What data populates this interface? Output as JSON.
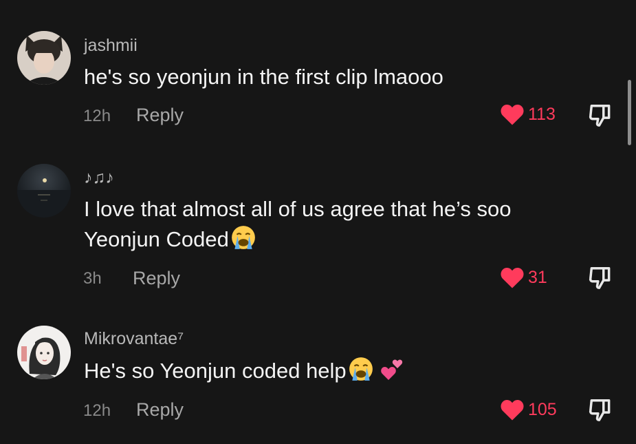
{
  "comments": [
    {
      "username": "jashmii",
      "text": "he's so yeonjun in the first clip lmaooo",
      "time": "12h",
      "reply_label": "Reply",
      "likes": "113",
      "avatar_icon": "user-avatar-cat-ears"
    },
    {
      "username": "♪♫♪",
      "text": "I love that almost all of us agree that he’s soo Yeonjun Coded",
      "emojis": [
        "loudly-crying-face"
      ],
      "time": "3h",
      "reply_label": "Reply",
      "likes": "31",
      "avatar_icon": "user-avatar-night-moon"
    },
    {
      "username": "Mikrovantae⁷",
      "text": "He's so Yeonjun coded help",
      "emojis": [
        "loudly-crying-face",
        "two-hearts"
      ],
      "time": "12h",
      "reply_label": "Reply",
      "likes": "105",
      "avatar_icon": "user-avatar-drawn-girl"
    }
  ],
  "colors": {
    "background": "#161616",
    "like_red": "#ff3b5c",
    "username_gray": "#b9b9b9",
    "meta_gray": "#8a8a8a"
  },
  "icons": {
    "like": "heart-icon",
    "dislike": "thumbs-down-icon"
  }
}
